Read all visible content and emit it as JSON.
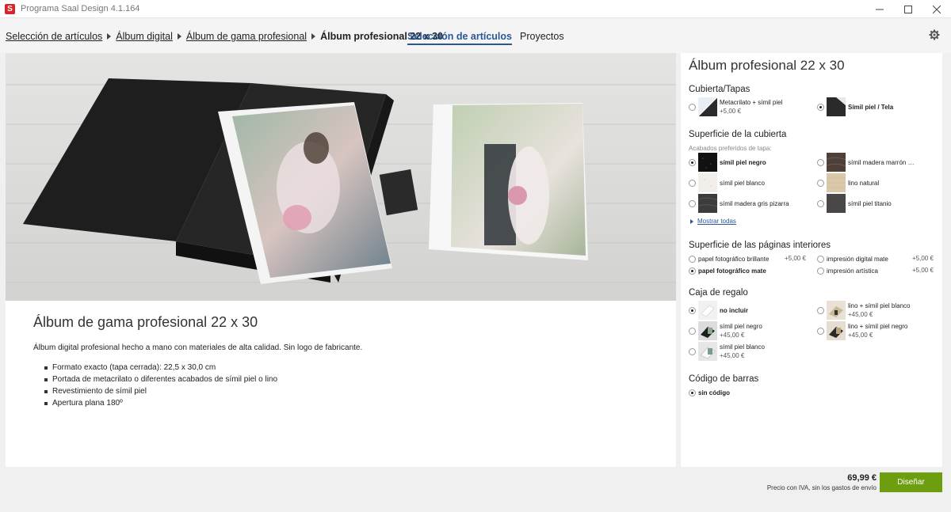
{
  "window": {
    "title": "Programa Saal Design 4.1.164",
    "logo_letter": "S"
  },
  "breadcrumb": {
    "items": [
      "Selección de artículos",
      "Álbum digital",
      "Álbum de gama profesional"
    ],
    "current": "Álbum profesional 22 x 30"
  },
  "top_tabs": [
    {
      "label": "Selección de artículos",
      "active": true
    },
    {
      "label": "Proyectos",
      "active": false
    }
  ],
  "description": {
    "title": "Álbum de gama profesional 22 x 30",
    "text": "Álbum digital profesional hecho a mano con materiales de alta calidad. Sin logo de fabricante.",
    "features": [
      "Formato exacto (tapa cerrada): 22,5 x 30,0 cm",
      "Portada de metacrilato o diferentes acabados de símil piel o lino",
      "Revestimiento de símil piel",
      "Apertura plana 180º"
    ]
  },
  "config": {
    "title": "Álbum profesional 22 x 30",
    "cover": {
      "title": "Cubierta/Tapas",
      "options": [
        {
          "label": "Metacrilato + símil piel",
          "price": "+5,00 €",
          "selected": false
        },
        {
          "label": "Símil piel / Tela",
          "price": "",
          "selected": true
        }
      ]
    },
    "surface": {
      "title": "Superficie de la cubierta",
      "sublabel": "Acabados preferidos de tapa:",
      "options": [
        {
          "label": "símil piel negro",
          "selected": true
        },
        {
          "label": "símil madera marrón …",
          "selected": false
        },
        {
          "label": "símil piel blanco",
          "selected": false
        },
        {
          "label": "lino natural",
          "selected": false
        },
        {
          "label": "símil madera gris pizarra",
          "selected": false
        },
        {
          "label": "símil piel titanio",
          "selected": false
        }
      ],
      "show_all": "Mostrar todas"
    },
    "inner_pages": {
      "title": "Superficie de las páginas interiores",
      "options": [
        {
          "label": "papel fotográfico brillante",
          "price": "+5,00 €",
          "selected": false
        },
        {
          "label": "impresión digital mate",
          "price": "+5,00 €",
          "selected": false
        },
        {
          "label": "papel fotográfico mate",
          "price": "",
          "selected": true
        },
        {
          "label": "impresión artística",
          "price": "+5,00 €",
          "selected": false
        }
      ]
    },
    "gift_box": {
      "title": "Caja de regalo",
      "options": [
        {
          "label": "no incluir",
          "price": "",
          "selected": true
        },
        {
          "label": "lino + símil piel blanco",
          "price": "+45,00 €",
          "selected": false
        },
        {
          "label": "símil piel negro",
          "price": "+45,00 €",
          "selected": false
        },
        {
          "label": "lino + símil piel negro",
          "price": "+45,00 €",
          "selected": false
        },
        {
          "label": "símil piel blanco",
          "price": "+45,00 €",
          "selected": false
        }
      ]
    },
    "barcode": {
      "title": "Código de barras",
      "options": [
        {
          "label": "sin código",
          "selected": true
        }
      ]
    }
  },
  "footer": {
    "price": "69,99 €",
    "note": "Precio con IVA, sin los gastos de envío",
    "design_button": "Diseñar"
  },
  "colors": {
    "accent": "#2b5797",
    "button": "#6d9e0f",
    "logo": "#d6262c"
  }
}
